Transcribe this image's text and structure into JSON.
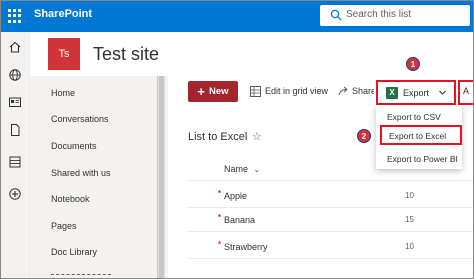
{
  "suitebar": {
    "app_name": "SharePoint",
    "search_placeholder": "Search this list"
  },
  "site": {
    "logo_initials": "Ts",
    "title": "Test site"
  },
  "appbar": {
    "icons": [
      "home-icon",
      "globe-icon",
      "news-icon",
      "document-icon",
      "list-icon",
      "add-icon"
    ]
  },
  "leftnav": {
    "items": [
      {
        "label": "Home"
      },
      {
        "label": "Conversations"
      },
      {
        "label": "Documents"
      },
      {
        "label": "Shared with us"
      },
      {
        "label": "Notebook"
      },
      {
        "label": "Pages"
      },
      {
        "label": "Doc Library"
      }
    ]
  },
  "commandbar": {
    "new_label": "New",
    "edit_grid_label": "Edit in grid view",
    "share_label": "Share",
    "export_label": "Export"
  },
  "export_menu": {
    "items": [
      {
        "label": "Export to CSV"
      },
      {
        "label": "Export to Excel"
      },
      {
        "label": "Export to Power BI"
      }
    ]
  },
  "badges": {
    "first": "1",
    "second": "2"
  },
  "list": {
    "title": "List to Excel",
    "columns": {
      "name": "Name"
    },
    "rows": [
      {
        "name": "Apple",
        "quantity": "10"
      },
      {
        "name": "Banana",
        "quantity": "15"
      },
      {
        "name": "Strawberry",
        "quantity": "10"
      }
    ]
  },
  "colors": {
    "suitebar": "#0078d4",
    "new_button": "#a4262c",
    "highlight": "#e81123",
    "site_logo": "#d13438",
    "excel": "#217346"
  }
}
